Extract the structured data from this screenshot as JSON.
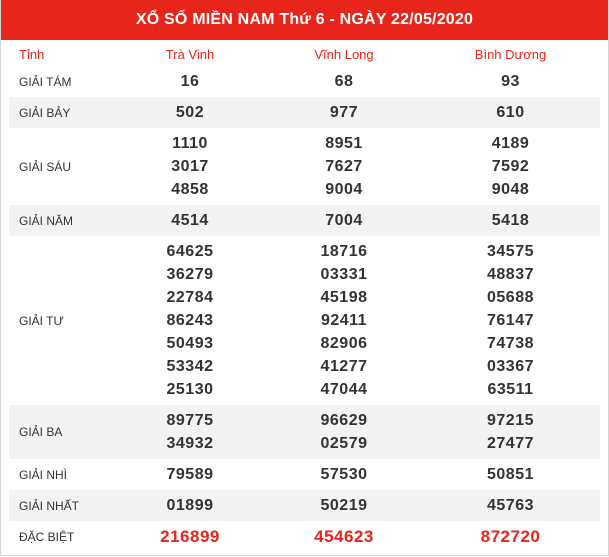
{
  "header": {
    "title": "XỔ SỐ MIỀN NAM Thứ 6 - NGÀY 22/05/2020"
  },
  "table": {
    "corner_label": "Tỉnh",
    "provinces": [
      "Trà Vinh",
      "Vĩnh Long",
      "Bình Dương"
    ],
    "rows": [
      {
        "label": "GIẢI TÁM",
        "values": [
          [
            "16"
          ],
          [
            "68"
          ],
          [
            "93"
          ]
        ]
      },
      {
        "label": "GIẢI BẢY",
        "values": [
          [
            "502"
          ],
          [
            "977"
          ],
          [
            "610"
          ]
        ]
      },
      {
        "label": "GIẢI SÁU",
        "values": [
          [
            "1110",
            "3017",
            "4858"
          ],
          [
            "8951",
            "7627",
            "9004"
          ],
          [
            "4189",
            "7592",
            "9048"
          ]
        ]
      },
      {
        "label": "GIẢI NĂM",
        "values": [
          [
            "4514"
          ],
          [
            "7004"
          ],
          [
            "5418"
          ]
        ]
      },
      {
        "label": "GIẢI TƯ",
        "values": [
          [
            "64625",
            "36279",
            "22784",
            "86243",
            "50493",
            "53342",
            "25130"
          ],
          [
            "18716",
            "03331",
            "45198",
            "92411",
            "82906",
            "41277",
            "47044"
          ],
          [
            "34575",
            "48837",
            "05688",
            "76147",
            "74738",
            "03367",
            "63511"
          ]
        ]
      },
      {
        "label": "GIẢI BA",
        "values": [
          [
            "89775",
            "34932"
          ],
          [
            "96629",
            "02579"
          ],
          [
            "97215",
            "27477"
          ]
        ]
      },
      {
        "label": "GIẢI NHÌ",
        "values": [
          [
            "79589"
          ],
          [
            "57530"
          ],
          [
            "50851"
          ]
        ]
      },
      {
        "label": "GIẢI NHẤT",
        "values": [
          [
            "01899"
          ],
          [
            "50219"
          ],
          [
            "45763"
          ]
        ]
      },
      {
        "label": "ĐẶC BIỆT",
        "values": [
          [
            "216899"
          ],
          [
            "454623"
          ],
          [
            "872720"
          ]
        ],
        "special": true
      }
    ]
  }
}
